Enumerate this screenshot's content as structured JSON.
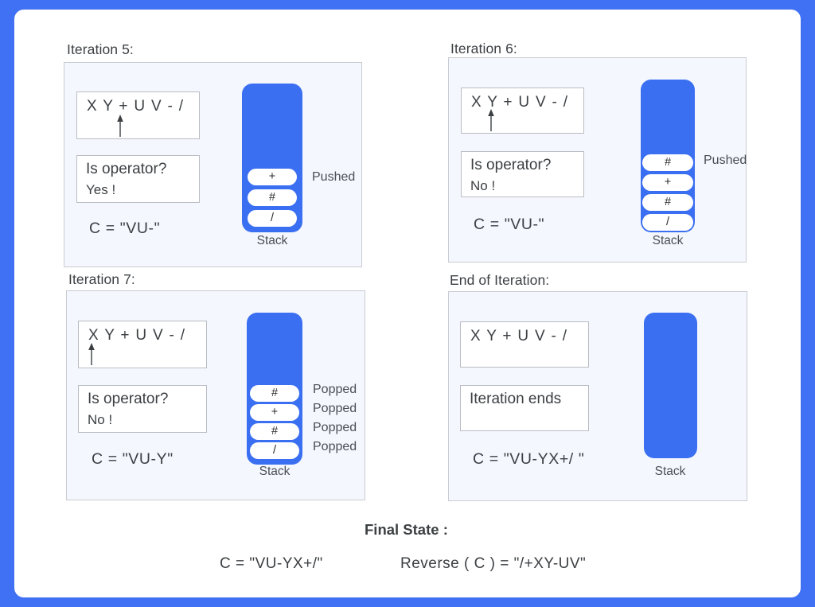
{
  "theme": {
    "frame_color": "#4070f4",
    "sheet_color": "#ffffff",
    "panel_bg": "#f4f7fd",
    "panel_border": "#c9ccd1",
    "stack_blue": "#3b6ff2",
    "text_color": "#3c4043"
  },
  "panels": [
    {
      "title": "Iteration 5:",
      "expression": "X Y + U V - /",
      "pointer_index": 2,
      "question": "Is operator?",
      "answer": "Yes !",
      "result": "C = \"VU-\"",
      "stack": {
        "label": "Stack",
        "items": [
          "+",
          "#",
          "/"
        ],
        "side_labels": [
          "Pushed"
        ]
      }
    },
    {
      "title": "Iteration 6:",
      "expression": "X Y + U V - /",
      "pointer_index": 1,
      "question": "Is operator?",
      "answer": "No !",
      "result": "C = \"VU-\"",
      "stack": {
        "label": "Stack",
        "items": [
          "#",
          "+",
          "#",
          "/"
        ],
        "side_labels": [
          "Pushed"
        ]
      }
    },
    {
      "title": "Iteration 7:",
      "expression": "X Y + U V - /",
      "pointer_index": 0,
      "question": "Is operator?",
      "answer": "No !",
      "result": "C = \"VU-Y\"",
      "stack": {
        "label": "Stack",
        "items": [
          "#",
          "+",
          "#",
          "/"
        ],
        "side_labels": [
          "Popped",
          "Popped",
          "Popped",
          "Popped"
        ]
      }
    },
    {
      "title": "End of Iteration:",
      "expression": "X Y + U V - /",
      "pointer_index": -1,
      "question": "Iteration ends",
      "answer": "",
      "result": "C = \"VU-YX+/ \"",
      "stack": {
        "label": "Stack",
        "items": [],
        "side_labels": []
      }
    }
  ],
  "footer": {
    "title": "Final State :",
    "left": "C = \"VU-YX+/\"",
    "right": "Reverse ( C ) = \"/+XY-UV\""
  }
}
